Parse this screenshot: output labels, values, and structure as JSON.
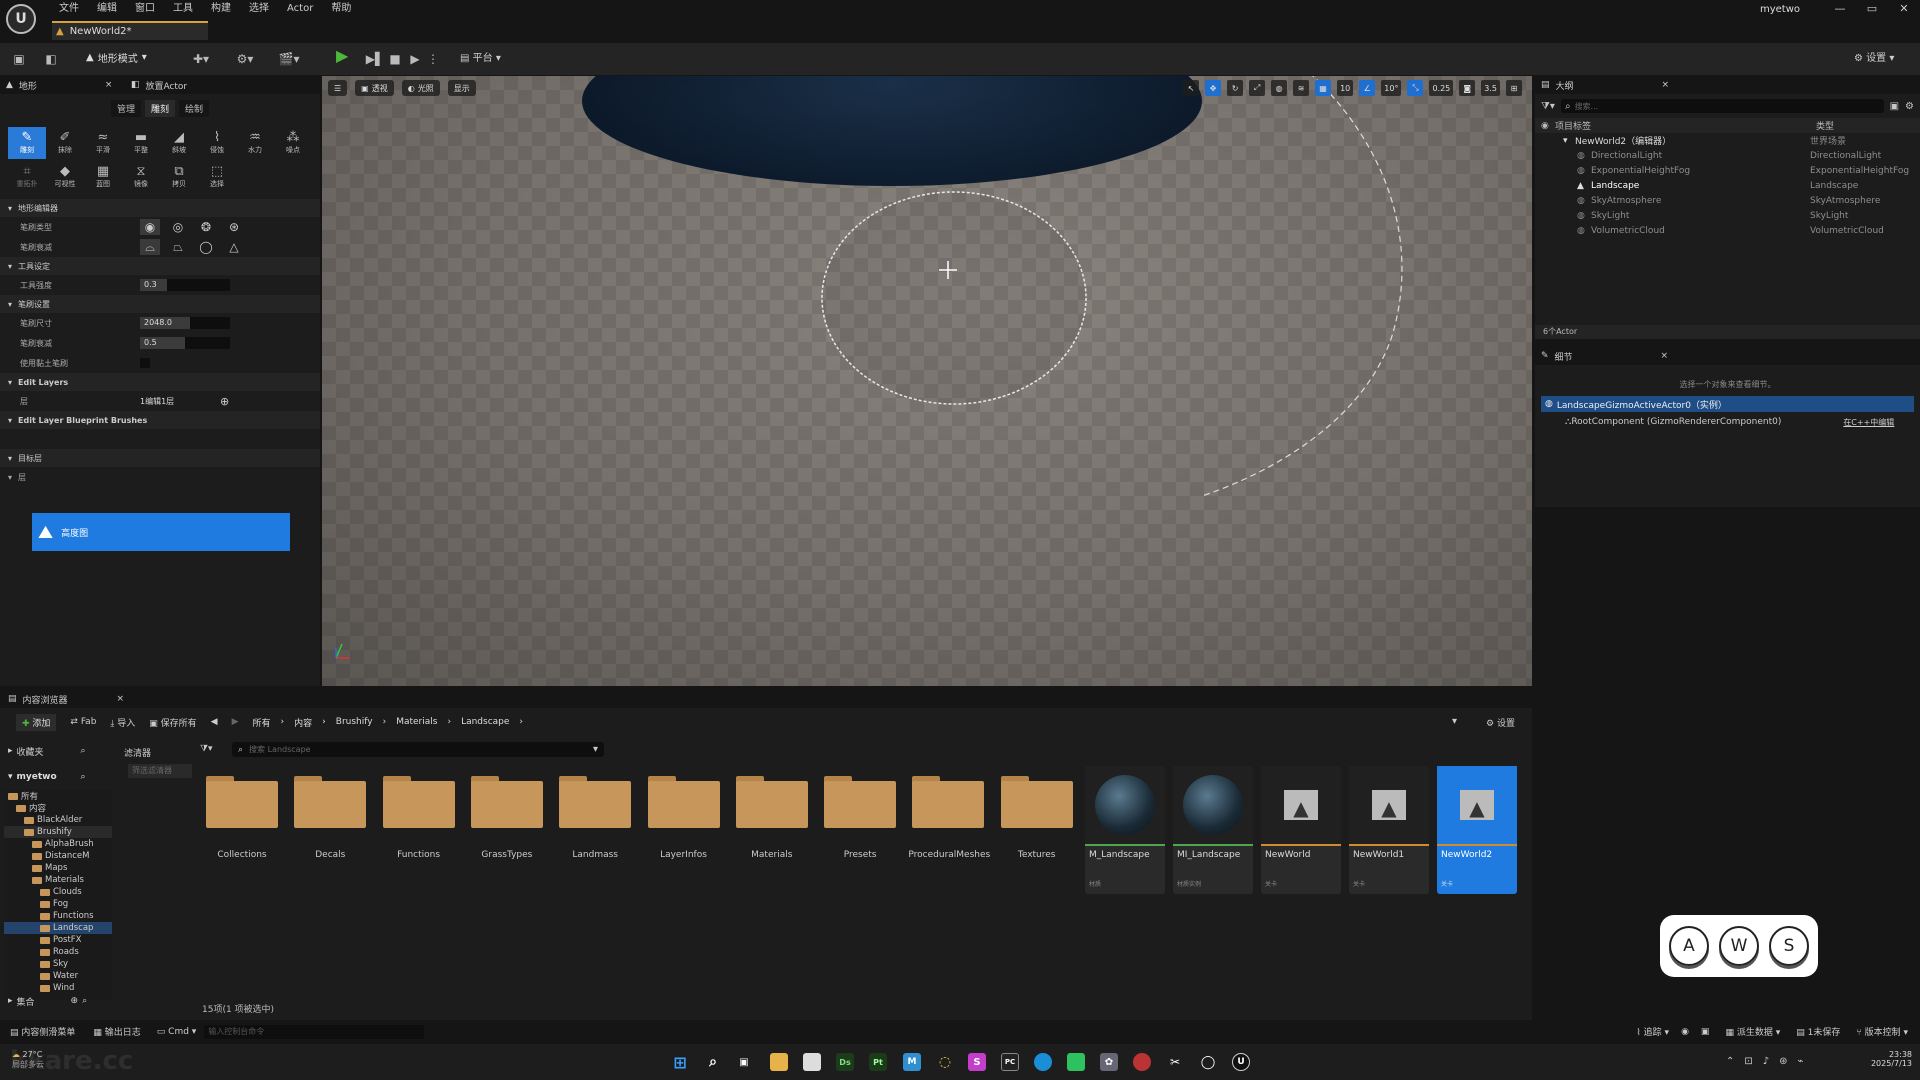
{
  "app": {
    "logo": "U",
    "document_tab": "NewWorld2*",
    "user": "myetwo",
    "win_controls": [
      "—",
      "▭",
      "✕"
    ]
  },
  "menu": [
    "文件",
    "编辑",
    "窗口",
    "工具",
    "构建",
    "选择",
    "Actor",
    "帮助"
  ],
  "toolbar": {
    "mode": "地形模式",
    "platform": "平台",
    "settings": "设置",
    "colors": {
      "play": "#4db83b"
    }
  },
  "left_panel": {
    "tab_landscape": "地形",
    "tab_place": "放置Actor",
    "subtabs": [
      "管理",
      "雕刻",
      "绘制"
    ],
    "active_subtab": "雕刻",
    "tools": [
      {
        "label": "雕刻",
        "icon": "brush-icon",
        "active": true
      },
      {
        "label": "抹除",
        "icon": "eraser-icon"
      },
      {
        "label": "平滑",
        "icon": "smooth-icon"
      },
      {
        "label": "平整",
        "icon": "flatten-icon"
      },
      {
        "label": "斜坡",
        "icon": "ramp-icon"
      },
      {
        "label": "侵蚀",
        "icon": "erosion-icon"
      },
      {
        "label": "水力",
        "icon": "hydro-icon"
      },
      {
        "label": "噪点",
        "icon": "noise-icon"
      },
      {
        "label": "重拓扑",
        "icon": "retopo-icon",
        "dim": true
      },
      {
        "label": "可视性",
        "icon": "visibility-icon"
      },
      {
        "label": "蓝图",
        "icon": "blueprint-icon"
      },
      {
        "label": "镜像",
        "icon": "mirror-icon"
      },
      {
        "label": "拷贝",
        "icon": "copy-icon"
      },
      {
        "label": "选择",
        "icon": "select-icon"
      }
    ],
    "sections": {
      "brush_editor": "地形编辑器",
      "brush_type": "笔刷类型",
      "brush_falloff": "笔刷衰减",
      "tool_settings": "工具设定",
      "tool_strength": "工具强度",
      "tool_strength_value": "0.3",
      "tool_strength_fill": 0.3,
      "brush_settings": "笔刷设置",
      "brush_size": "笔刷尺寸",
      "brush_size_value": "2048.0",
      "brush_size_fill": 0.55,
      "brush_falloff_label": "笔刷衰减",
      "brush_falloff_value": "0.5",
      "brush_falloff_fill": 0.5,
      "use_clay": "使用黏土笔刷",
      "edit_layers": "Edit Layers",
      "layer_label": "层",
      "layer_value": "1编辑1层",
      "bp_brushes": "Edit Layer Blueprint Brushes",
      "target_layer": "目标层",
      "target_layer_sub": "层",
      "heightmap": "高度图"
    }
  },
  "viewport": {
    "buttons": [
      "透视",
      "光照",
      "显示"
    ],
    "snap_grid": "10",
    "snap_rot": "10°",
    "snap_scale": "0.25",
    "camera_speed": "3.5"
  },
  "outliner": {
    "title": "大纲",
    "search_placeholder": "搜索...",
    "col_name": "项目标签",
    "col_type": "类型",
    "world": "NewWorld2（编辑器）",
    "world_type": "世界场景",
    "items": [
      {
        "name": "DirectionalLight",
        "type": "DirectionalLight"
      },
      {
        "name": "ExponentialHeightFog",
        "type": "ExponentialHeightFog"
      },
      {
        "name": "Landscape",
        "type": "Landscape",
        "highlight": true
      },
      {
        "name": "SkyAtmosphere",
        "type": "SkyAtmosphere"
      },
      {
        "name": "SkyLight",
        "type": "SkyLight"
      },
      {
        "name": "VolumetricCloud",
        "type": "VolumetricCloud"
      }
    ],
    "count": "6个Actor"
  },
  "details": {
    "title": "细节",
    "hint": "选择一个对象来查看细节。",
    "actor": "LandscapeGizmoActiveActor0（实例）",
    "component": "RootComponent (GizmoRendererComponent0)",
    "edit_link": "在C++中编辑"
  },
  "content_browser": {
    "title": "内容浏览器",
    "add": "添加",
    "fab": "Fab",
    "import": "导入",
    "save_all": "保存所有",
    "settings": "设置",
    "breadcrumb": [
      "所有",
      "内容",
      "Brushify",
      "Materials",
      "Landscape"
    ],
    "favorites": "收藏夹",
    "project": "myetwo",
    "filters": "滤清器",
    "filter_placeholder": "筛选滤清器",
    "search_placeholder": "搜索 Landscape",
    "collections": "集合",
    "tree": [
      {
        "label": "所有",
        "d": 0
      },
      {
        "label": "内容",
        "d": 1
      },
      {
        "label": "BlackAlder",
        "d": 2
      },
      {
        "label": "Brushify",
        "d": 2,
        "sel": true
      },
      {
        "label": "AlphaBrush",
        "d": 3
      },
      {
        "label": "DistanceM",
        "d": 3
      },
      {
        "label": "Maps",
        "d": 3
      },
      {
        "label": "Materials",
        "d": 3
      },
      {
        "label": "Clouds",
        "d": 4
      },
      {
        "label": "Fog",
        "d": 4
      },
      {
        "label": "Functions",
        "d": 4
      },
      {
        "label": "Landscap",
        "d": 4,
        "cur": true
      },
      {
        "label": "PostFX",
        "d": 4
      },
      {
        "label": "Roads",
        "d": 4
      },
      {
        "label": "Sky",
        "d": 4
      },
      {
        "label": "Water",
        "d": 4
      },
      {
        "label": "Wind",
        "d": 4
      }
    ],
    "folders": [
      "Collections",
      "Decals",
      "Functions",
      "GrassTypes",
      "Landmass",
      "LayerInfos",
      "Materials",
      "Presets",
      "ProceduralMeshes",
      "Textures"
    ],
    "assets": [
      {
        "name": "M_Landscape",
        "sub": "材质",
        "kind": "material",
        "bar": "#4fa64f"
      },
      {
        "name": "MI_Landscape",
        "sub": "材质实例",
        "kind": "material",
        "bar": "#4fa64f"
      },
      {
        "name": "NewWorld",
        "sub": "关卡",
        "kind": "level",
        "bar": "#d08a30"
      },
      {
        "name": "NewWorld1",
        "sub": "关卡",
        "kind": "level",
        "bar": "#d08a30"
      },
      {
        "name": "NewWorld2",
        "sub": "关卡",
        "kind": "level",
        "bar": "#d08a30",
        "selected": true
      }
    ],
    "status": "15项(1 项被选中)"
  },
  "statusbar": {
    "drawer": "内容侧滑菜单",
    "output": "输出日志",
    "cmd": "Cmd",
    "cmd_placeholder": "输入控制台命令",
    "trace": "追踪",
    "derived": "派生数据",
    "unsaved": "1未保存",
    "version": "版本控制"
  },
  "taskbar": {
    "weather": "27°C",
    "weather_sub": "局部多云",
    "time": "23:38",
    "date": "2025/7/13",
    "watermark": "kkare.cc"
  },
  "keys": [
    "A",
    "W",
    "S"
  ]
}
